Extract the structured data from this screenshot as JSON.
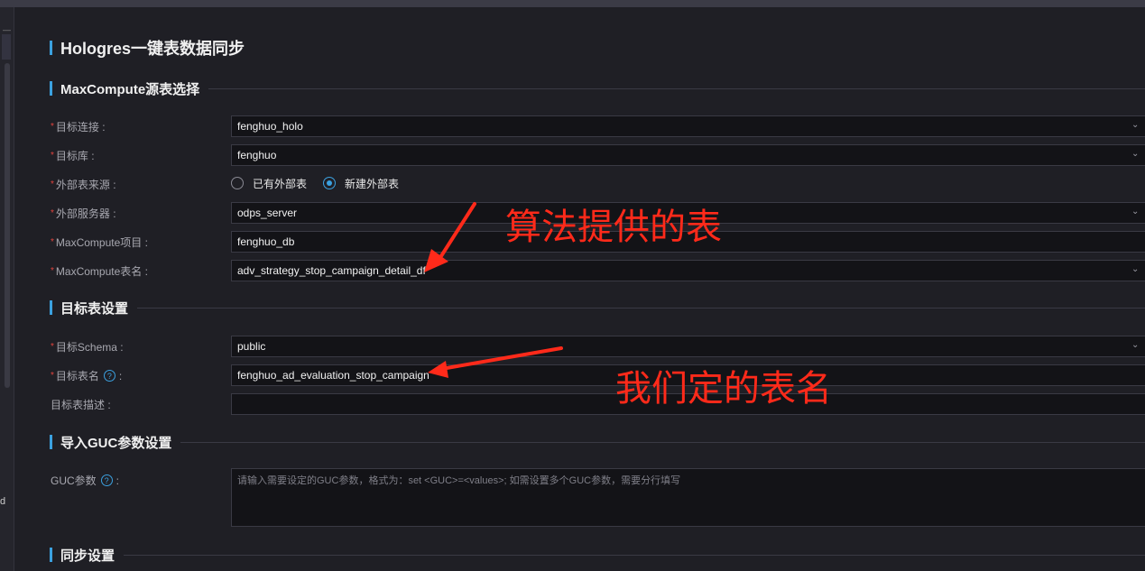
{
  "page": {
    "title": "Hologres一键表数据同步"
  },
  "sections": {
    "source": "MaxCompute源表选择",
    "target": "目标表设置",
    "guc": "导入GUC参数设置",
    "sync": "同步设置"
  },
  "form": {
    "target_connection": {
      "label": "目标连接 :",
      "value": "fenghuo_holo"
    },
    "target_db": {
      "label": "目标库 :",
      "value": "fenghuo"
    },
    "external_source": {
      "label": "外部表来源 :",
      "options": [
        "已有外部表",
        "新建外部表"
      ],
      "selected": "新建外部表"
    },
    "external_server": {
      "label": "外部服务器 :",
      "value": "odps_server"
    },
    "mc_project": {
      "label": "MaxCompute项目 :",
      "value": "fenghuo_db"
    },
    "mc_table": {
      "label": "MaxCompute表名 :",
      "value": "adv_strategy_stop_campaign_detail_df"
    },
    "target_schema": {
      "label": "目标Schema :",
      "value": "public"
    },
    "target_table": {
      "label": "目标表名",
      "value": "fenghuo_ad_evaluation_stop_campaign"
    },
    "target_desc": {
      "label": "目标表描述 :",
      "value": ""
    },
    "guc_params": {
      "label": "GUC参数",
      "placeholder": "请输入需要设定的GUC参数，格式为：set <GUC>=<values>; 如需设置多个GUC参数，需要分行填写"
    }
  },
  "annotations": {
    "algo_table": "算法提供的表",
    "our_table": "我们定的表名"
  },
  "sidebar": {
    "glyph": "d",
    "dash": "—"
  },
  "colors": {
    "accent": "#3ba1e0",
    "required": "#e0443e",
    "annotation": "#ff2a1a"
  }
}
